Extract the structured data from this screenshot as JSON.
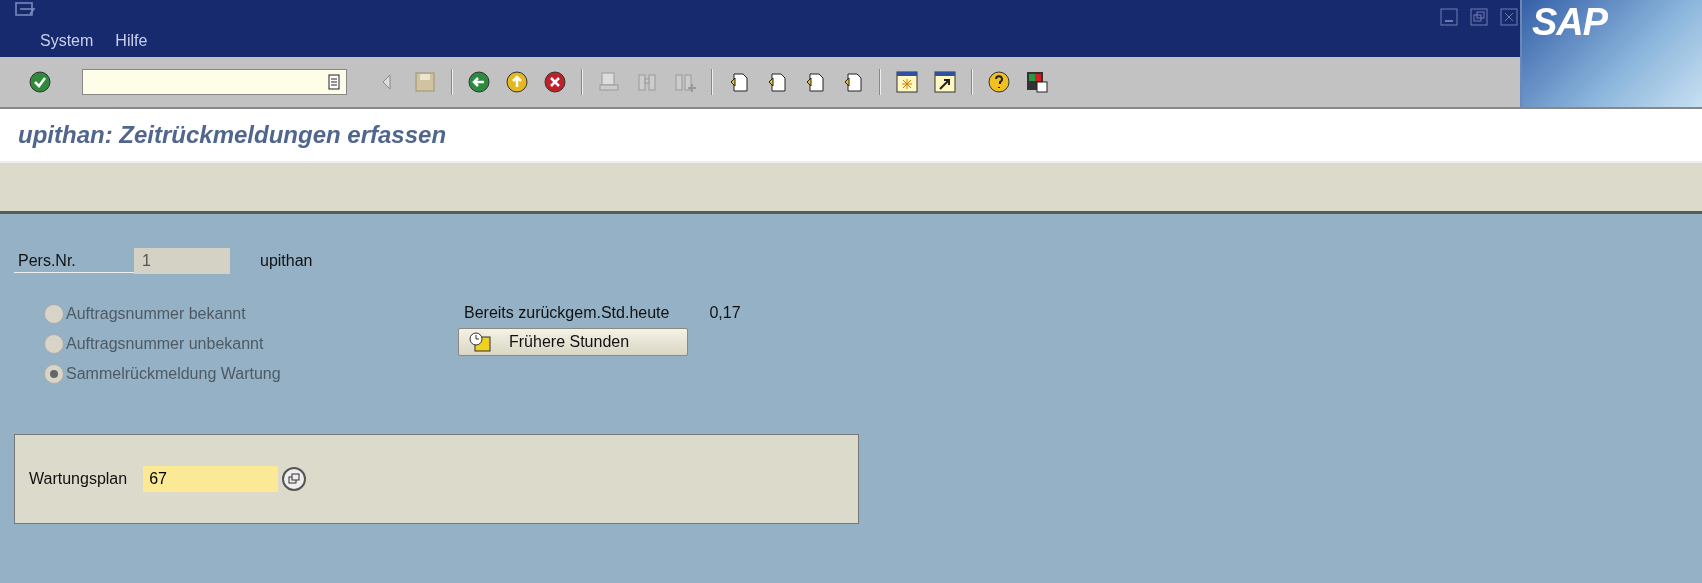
{
  "logo": "SAP",
  "menu": [
    {
      "label": "System"
    },
    {
      "label": "Hilfe"
    }
  ],
  "screen_title": "upithan: Zeitrückmeldungen erfassen",
  "personnel": {
    "label": "Pers.Nr.",
    "value": "1",
    "name": "upithan"
  },
  "options": [
    {
      "label": "Auftragsnummer bekannt",
      "selected": false,
      "disabled": true
    },
    {
      "label": "Auftragsnummer unbekannt",
      "selected": false,
      "disabled": true
    },
    {
      "label": "Sammelrückmeldung Wartung",
      "selected": true,
      "disabled": true
    }
  ],
  "hours": {
    "label": "Bereits zurückgem.Std.heute",
    "value": "0,17"
  },
  "history_button": {
    "label": "Frühere Stunden"
  },
  "maintenance_plan": {
    "label": "Wartungsplan",
    "value": "67"
  }
}
